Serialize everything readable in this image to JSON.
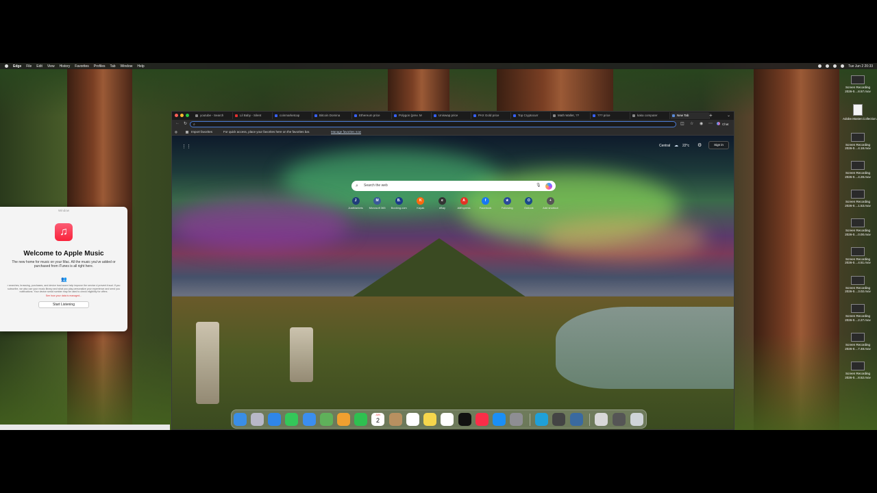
{
  "menubar": {
    "items": [
      "Edge",
      "File",
      "Edit",
      "View",
      "History",
      "Favorites",
      "Profiles",
      "Tab",
      "Window",
      "Help"
    ],
    "clock": "Tue Jun 2  20:33"
  },
  "music_window": {
    "window_title": "Window",
    "heading": "Welcome to Apple Music",
    "subtitle": "The new home for music on your Mac. All the music you've added or purchased from iTunes is all right here.",
    "fine_print": "r searches, browsing, purchases, and device trust score help improve the service d prevent fraud. If you subscribe, we also use your music library and what you play personalize your experience and send you notifications. Your device serial number may be used to check eligibility for offers.",
    "data_link": "See how your data is managed...",
    "start_button": "Start Listening"
  },
  "browser": {
    "tabs": [
      {
        "label": "youtube - Search",
        "color": "#888888"
      },
      {
        "label": "Lil Baby - Silent",
        "color": "#e33030"
      },
      {
        "label": "coinmarketcap",
        "color": "#3861fb"
      },
      {
        "label": "Bitcoin Domina",
        "color": "#3861fb"
      },
      {
        "label": "Ethereum price",
        "color": "#3861fb"
      },
      {
        "label": "Polygon (prev. M",
        "color": "#3861fb"
      },
      {
        "label": "Uniswap price",
        "color": "#3861fb"
      },
      {
        "label": "PAX Gold price",
        "color": "#3861fb"
      },
      {
        "label": "Top Cryptocurr",
        "color": "#3861fb"
      },
      {
        "label": "Math Wallet, ??",
        "color": "#888888"
      },
      {
        "label": "??? price",
        "color": "#3861fb"
      },
      {
        "label": "kaka computer",
        "color": "#888888"
      },
      {
        "label": "New Tab",
        "color": "#5a8ad8"
      }
    ],
    "favorites_bar": {
      "import": "Import favorites",
      "hint": "For quick access, place your favorites here on the favorites bar.",
      "manage_link": "Manage favorites now"
    },
    "chat_label": "Chat",
    "new_tab_page": {
      "weather_location": "Central",
      "weather_temp": "22°c",
      "sign_in": "Sign in",
      "search_placeholder": "Search the web",
      "shortcuts": [
        {
          "label": "JustMarkets",
          "icon": "J",
          "color": "#1f3d7a"
        },
        {
          "label": "Microsoft 365",
          "icon": "M",
          "color": "#3a5a9a"
        },
        {
          "label": "Booking.com",
          "icon": "B.",
          "color": "#1a3b8a"
        },
        {
          "label": "Kayak",
          "icon": "K",
          "color": "#ff690f"
        },
        {
          "label": "eBay",
          "icon": "e",
          "color": "#333333"
        },
        {
          "label": "AliExpress",
          "icon": "A",
          "color": "#e43225"
        },
        {
          "label": "Facebook",
          "icon": "f",
          "color": "#1877f2"
        },
        {
          "label": "Following",
          "icon": "★",
          "color": "#2a4a9a"
        },
        {
          "label": "Outlook",
          "icon": "O",
          "color": "#1a4a8a"
        },
        {
          "label": "Add shortcut",
          "icon": "+",
          "color": "#555555"
        }
      ]
    }
  },
  "dock_apps": [
    {
      "name": "finder",
      "color": "#3a8ee6"
    },
    {
      "name": "launchpad",
      "color": "#b8b8c8"
    },
    {
      "name": "safari",
      "color": "#2f86e8"
    },
    {
      "name": "messages",
      "color": "#34c759"
    },
    {
      "name": "mail",
      "color": "#3b8ef0"
    },
    {
      "name": "maps",
      "color": "#5fb15a"
    },
    {
      "name": "photos",
      "color": "#f0a030"
    },
    {
      "name": "facetime",
      "color": "#2ec050"
    },
    {
      "name": "calendar",
      "color": "#ffffff"
    },
    {
      "name": "contacts",
      "color": "#b89060"
    },
    {
      "name": "reminders",
      "color": "#ffffff"
    },
    {
      "name": "notes",
      "color": "#f6d64c"
    },
    {
      "name": "freeform",
      "color": "#ffffff"
    },
    {
      "name": "tv",
      "color": "#111111"
    },
    {
      "name": "music",
      "color": "#fa2d48"
    },
    {
      "name": "app-store",
      "color": "#1b8ff5"
    },
    {
      "name": "system-settings",
      "color": "#8e8e93"
    },
    {
      "name": "edge",
      "color": "#1fa0d8"
    },
    {
      "name": "calculator",
      "color": "#444444"
    },
    {
      "name": "quicktime",
      "color": "#3a6aa0"
    },
    {
      "name": "preview",
      "color": "#d8d8d8"
    },
    {
      "name": "calculator-2",
      "color": "#555555"
    },
    {
      "name": "trash",
      "color": "#cfd4d8"
    }
  ],
  "calendar_icon": {
    "month": "JUN",
    "day": "2"
  },
  "desktop_files": [
    "Screen Recording 2026-0....8.57.mov",
    "Adobe.Master.Collection.C....VoTi.tar",
    "Screen Recording 2026-0....4.18.mov",
    "Screen Recording 2026-0....4.28.mov",
    "Screen Recording 2026-0....1.53.mov",
    "Screen Recording 2026-0....0.00.mov",
    "Screen Recording 2026-0....4.51.mov",
    "Screen Recording 2026-0....3.02.mov",
    "Screen Recording 2026-0....2.27.mov",
    "Screen Recording 2026-0....7.48.mov",
    "Screen Recording 2026-0....8.52.mov"
  ]
}
